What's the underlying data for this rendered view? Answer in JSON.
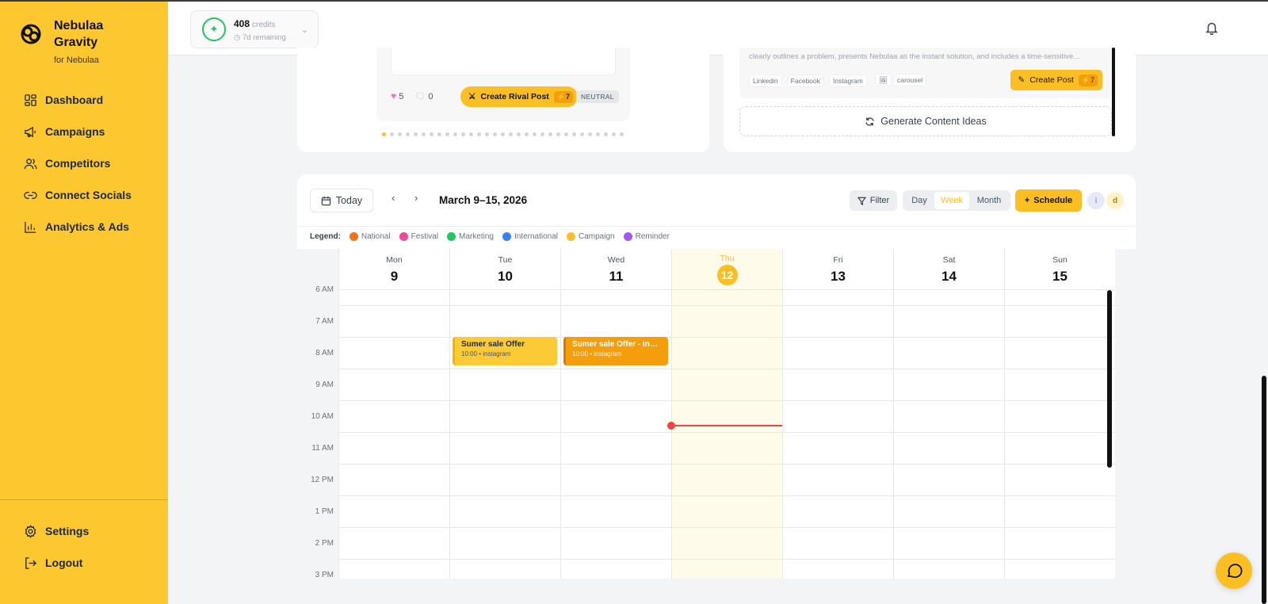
{
  "brand": {
    "name_line1": "Nebulaa",
    "name_line2": "Gravity",
    "sub": "for Nebulaa"
  },
  "nav": {
    "items": [
      {
        "label": "Dashboard",
        "icon": "grid-icon"
      },
      {
        "label": "Campaigns",
        "icon": "megaphone-icon"
      },
      {
        "label": "Competitors",
        "icon": "users-icon"
      },
      {
        "label": "Connect Socials",
        "icon": "link-icon"
      },
      {
        "label": "Analytics & Ads",
        "icon": "bar-chart-icon"
      }
    ],
    "bottom": [
      {
        "label": "Settings",
        "icon": "gear-icon"
      },
      {
        "label": "Logout",
        "icon": "logout-icon"
      }
    ]
  },
  "header": {
    "credits_value": "408",
    "credits_unit": "credits",
    "credits_remaining": "7d remaining"
  },
  "rival": {
    "likes": "5",
    "comments": "0",
    "create_label": "Create Rival Post",
    "credit_cost": "7",
    "sentiment": "NEUTRAL",
    "carousel_dots": 31,
    "active_dot": 0
  },
  "idea": {
    "text": "clearly outlines a problem, presents Nebulaa as the instant solution, and includes a time-sensitive...",
    "tags": [
      "Linkedin",
      "Facebook",
      "Instagram"
    ],
    "format": "carousel",
    "create_label": "Create Post",
    "credit_cost": "7",
    "generate_label": "Generate Content Ideas"
  },
  "calendar": {
    "today_label": "Today",
    "range_label": "March 9–15, 2026",
    "filter_label": "Filter",
    "views": [
      "Day",
      "Week",
      "Month"
    ],
    "active_view": "Week",
    "schedule_label": "Schedule",
    "avatars": [
      "i",
      "d"
    ],
    "legend_title": "Legend:",
    "legend": [
      {
        "label": "National",
        "color": "#f97316"
      },
      {
        "label": "Festival",
        "color": "#ec4899"
      },
      {
        "label": "Marketing",
        "color": "#22c55e"
      },
      {
        "label": "International",
        "color": "#3b82f6"
      },
      {
        "label": "Campaign",
        "color": "#fbbf24"
      },
      {
        "label": "Reminder",
        "color": "#a855f7"
      }
    ],
    "days": [
      {
        "name": "Mon",
        "num": "9"
      },
      {
        "name": "Tue",
        "num": "10"
      },
      {
        "name": "Wed",
        "num": "11"
      },
      {
        "name": "Thu",
        "num": "12",
        "today": true
      },
      {
        "name": "Fri",
        "num": "13"
      },
      {
        "name": "Sat",
        "num": "14"
      },
      {
        "name": "Sun",
        "num": "15"
      }
    ],
    "hours": [
      "6 AM",
      "7 AM",
      "8 AM",
      "9 AM",
      "10 AM",
      "11 AM",
      "12 PM",
      "1 PM",
      "2 PM",
      "3 PM"
    ],
    "events": [
      {
        "day": 1,
        "title": "Sumer sale Offer",
        "meta": "10:00 • instagram",
        "style": "yellow"
      },
      {
        "day": 2,
        "title": "Sumer sale Offer - insta...",
        "meta": "10:00 • instagram",
        "style": "orange"
      }
    ]
  }
}
